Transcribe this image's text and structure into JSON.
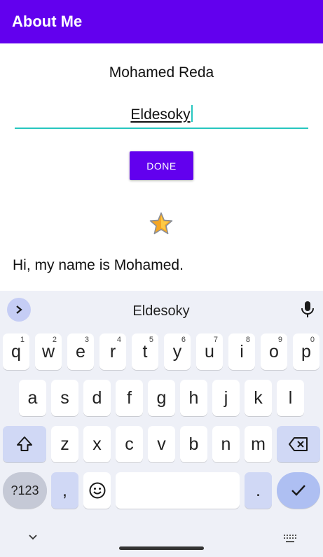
{
  "app_bar": {
    "title": "About Me",
    "color": "#6200ee"
  },
  "content": {
    "name": "Mohamed Reda",
    "nickname_value": "Eldesoky",
    "done_label": "DONE",
    "star_icon": "star-icon",
    "bio": "Hi, my name is Mohamed."
  },
  "keyboard": {
    "suggestion": "Eldesoky",
    "row1": [
      {
        "k": "q",
        "h": "1"
      },
      {
        "k": "w",
        "h": "2"
      },
      {
        "k": "e",
        "h": "3"
      },
      {
        "k": "r",
        "h": "4"
      },
      {
        "k": "t",
        "h": "5"
      },
      {
        "k": "y",
        "h": "6"
      },
      {
        "k": "u",
        "h": "7"
      },
      {
        "k": "i",
        "h": "8"
      },
      {
        "k": "o",
        "h": "9"
      },
      {
        "k": "p",
        "h": "0"
      }
    ],
    "row2": [
      "a",
      "s",
      "d",
      "f",
      "g",
      "h",
      "j",
      "k",
      "l"
    ],
    "row3": [
      "z",
      "x",
      "c",
      "v",
      "b",
      "n",
      "m"
    ],
    "num_label": "?123",
    "comma": ",",
    "period": "."
  }
}
